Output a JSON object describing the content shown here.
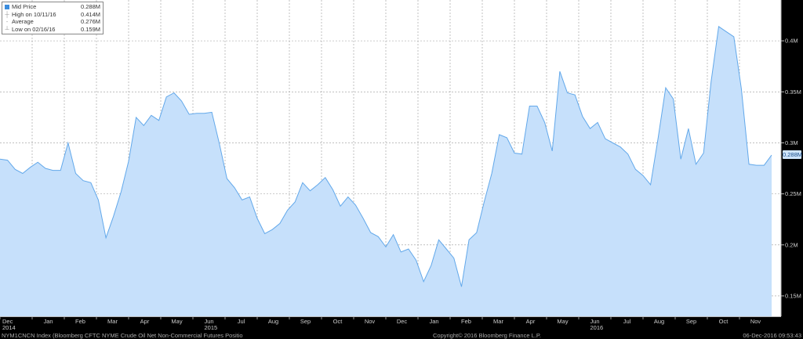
{
  "legend": {
    "mid_label": "Mid Price",
    "mid_value": "0.288M",
    "high_label": "High on 10/11/16",
    "high_value": "0.414M",
    "avg_label": "Average",
    "avg_value": "0.276M",
    "low_label": "Low on 02/16/16",
    "low_value": "0.159M"
  },
  "price_tag": "0.288M",
  "footer": {
    "left": "NYM1CNCN Index (Bloomberg CFTC NYME Crude Oil Net Non-Commercial Futures Positio",
    "center": "Copyright© 2016 Bloomberg Finance L.P.",
    "right": "06-Dec-2016 09:53:43"
  },
  "chart_data": {
    "type": "area",
    "ylim": [
      0.13,
      0.44
    ],
    "yticks": [
      0.15,
      0.2,
      0.25,
      0.3,
      0.35,
      0.4
    ],
    "ytick_labels": [
      "0.15M",
      "0.2M",
      "0.25M",
      "0.3M",
      "0.35M",
      "0.4M"
    ],
    "months": [
      {
        "label": "Dec",
        "year": "2014"
      },
      {
        "label": "Jan"
      },
      {
        "label": "Feb"
      },
      {
        "label": "Mar"
      },
      {
        "label": "Apr"
      },
      {
        "label": "May"
      },
      {
        "label": "Jun",
        "year": "2015"
      },
      {
        "label": "Jul"
      },
      {
        "label": "Aug"
      },
      {
        "label": "Sep"
      },
      {
        "label": "Oct"
      },
      {
        "label": "Nov"
      },
      {
        "label": "Dec"
      },
      {
        "label": "Jan"
      },
      {
        "label": "Feb"
      },
      {
        "label": "Mar"
      },
      {
        "label": "Apr"
      },
      {
        "label": "May"
      },
      {
        "label": "Jun",
        "year": "2016"
      },
      {
        "label": "Jul"
      },
      {
        "label": "Aug"
      },
      {
        "label": "Sep"
      },
      {
        "label": "Oct"
      },
      {
        "label": "Nov"
      }
    ],
    "values": [
      0.284,
      0.283,
      0.274,
      0.27,
      0.276,
      0.281,
      0.275,
      0.273,
      0.273,
      0.3,
      0.27,
      0.263,
      0.261,
      0.244,
      0.207,
      0.228,
      0.252,
      0.282,
      0.325,
      0.317,
      0.327,
      0.322,
      0.345,
      0.349,
      0.341,
      0.328,
      0.329,
      0.329,
      0.33,
      0.299,
      0.265,
      0.256,
      0.244,
      0.247,
      0.226,
      0.211,
      0.215,
      0.221,
      0.234,
      0.242,
      0.261,
      0.253,
      0.259,
      0.266,
      0.254,
      0.238,
      0.247,
      0.239,
      0.226,
      0.212,
      0.208,
      0.198,
      0.21,
      0.193,
      0.196,
      0.185,
      0.164,
      0.18,
      0.205,
      0.196,
      0.187,
      0.159,
      0.205,
      0.212,
      0.242,
      0.27,
      0.308,
      0.305,
      0.29,
      0.289,
      0.336,
      0.336,
      0.32,
      0.292,
      0.37,
      0.349,
      0.347,
      0.326,
      0.314,
      0.32,
      0.304,
      0.3,
      0.296,
      0.289,
      0.274,
      0.268,
      0.259,
      0.305,
      0.354,
      0.343,
      0.284,
      0.314,
      0.279,
      0.29,
      0.36,
      0.414,
      0.409,
      0.404,
      0.353,
      0.279,
      0.278,
      0.278,
      0.288
    ]
  }
}
